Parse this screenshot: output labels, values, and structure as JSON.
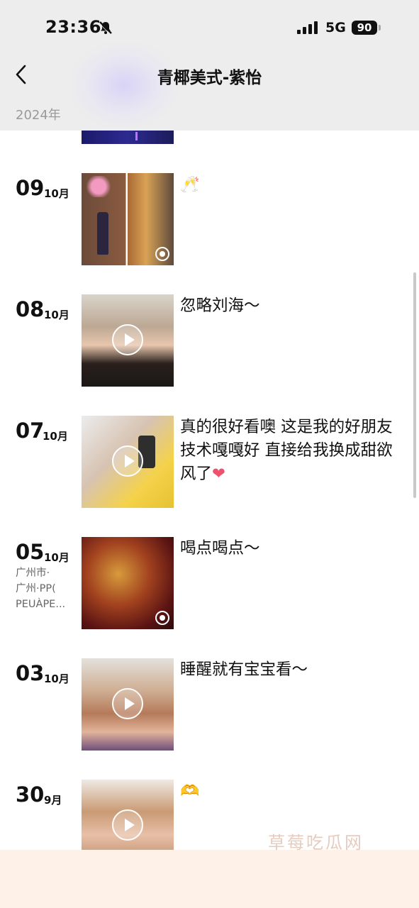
{
  "status_bar": {
    "time": "23:36",
    "network": "5G",
    "battery": "90"
  },
  "nav": {
    "title": "青椰美式-紫怡",
    "back_icon": "chevron-left-icon"
  },
  "year_label": "2024年",
  "entries": [
    {
      "day": "09",
      "month": "10月",
      "caption": "🥂",
      "media": "image",
      "location": []
    },
    {
      "day": "08",
      "month": "10月",
      "caption": "忽略刘海～",
      "media": "video",
      "location": []
    },
    {
      "day": "07",
      "month": "10月",
      "caption": "真的很好看噢 这是我的好朋友 技术嘎嘎好 直接给我换成甜欲风了",
      "caption_emoji": "❤",
      "media": "video",
      "location": []
    },
    {
      "day": "05",
      "month": "10月",
      "caption": "喝点喝点～",
      "media": "image",
      "location": [
        "广州市·",
        "广州·PP(",
        "PEUÀPE..."
      ]
    },
    {
      "day": "03",
      "month": "10月",
      "caption": "睡醒就有宝宝看～",
      "media": "video",
      "location": []
    },
    {
      "day": "30",
      "month": "9月",
      "caption": "🫶",
      "media": "video",
      "location": []
    }
  ],
  "watermark": "草莓吃瓜网",
  "colors": {
    "header_bg": "#ededed",
    "bottom_band": "#fdf1e8",
    "heart": "#f0506e"
  }
}
